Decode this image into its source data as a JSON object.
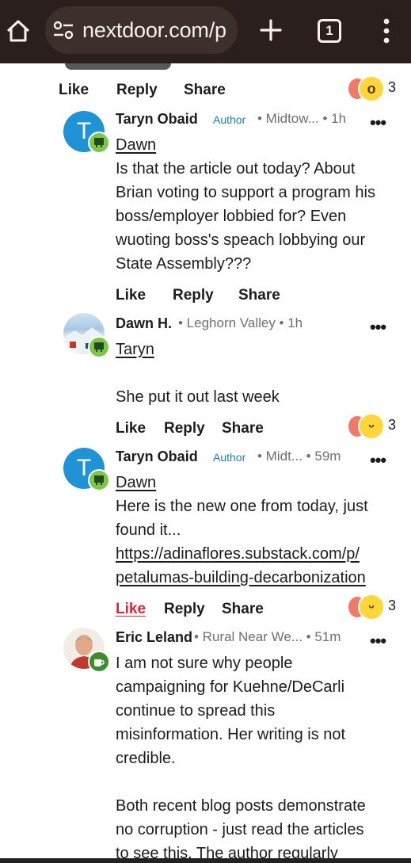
{
  "browser": {
    "url": "nextdoor.com/p",
    "tab_count": "1"
  },
  "actions": {
    "like": "Like",
    "reply": "Reply",
    "share": "Share"
  },
  "top_post": {
    "reaction_count": "3",
    "reaction_emoji": "wow"
  },
  "comments": [
    {
      "avatar_letter": "T",
      "name": "Taryn Obaid",
      "tag": "Author",
      "meta": "• Midtow... • 1h",
      "mention": "Dawn",
      "lines": [
        " Is that the article out today? About",
        "Brian voting to support a program his",
        "boss/employer lobbied for? Even",
        "wuoting boss's speach lobbying our",
        "State Assembly???"
      ]
    },
    {
      "name": "Dawn H.",
      "meta": "• Leghorn Valley • 1h",
      "mention": "Taryn",
      "lines": [
        "She put it out last week"
      ],
      "reaction_count": "3",
      "reaction_emoji": "smile"
    },
    {
      "avatar_letter": "T",
      "name": "Taryn Obaid",
      "tag": "Author",
      "meta": "• Midt...   • 59m",
      "mention": "Dawn",
      "lines": [
        " Here is the new one from today, just",
        "found it..."
      ],
      "link_lines": [
        "https://adinaflores.substack.com/p/",
        "petalumas-building-decarbonization"
      ],
      "reaction_count": "3",
      "reaction_emoji": "smile",
      "liked": true
    },
    {
      "name": "Eric Leland",
      "meta": "• Rural Near We...  • 51m",
      "lines": [
        "I am not sure why people",
        "campaigning for Kuehne/DeCarli",
        "continue to spread this",
        "misinformation. Her writing is not",
        "credible.",
        "",
        "Both recent blog posts demonstrate",
        "no corruption - just read the articles",
        "to see this. The author regularly"
      ]
    }
  ],
  "colors": {
    "browser_bar": "#2a1f1c",
    "author_tag": "#1e7bc7",
    "liked": "#d7263d",
    "badge": "#7ec54a",
    "avatar_t": "#1f93d6"
  }
}
